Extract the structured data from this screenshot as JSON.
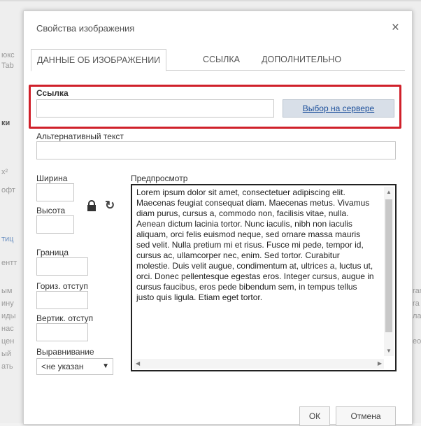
{
  "dialog": {
    "title": "Свойства изображения",
    "close_symbol": "×",
    "tabs": [
      {
        "label": "ДАННЫЕ ОБ ИЗОБРАЖЕНИИ",
        "active": true
      },
      {
        "label": "ССЫЛКА",
        "active": false
      },
      {
        "label": "ДОПОЛНИТЕЛЬНО",
        "active": false
      }
    ],
    "fields": {
      "link_label": "Ссылка",
      "link_value": "",
      "browse_server_label": "Выбор на сервере",
      "alt_label": "Альтернативный текст",
      "alt_value": "",
      "width_label": "Ширина",
      "height_label": "Высота",
      "border_label": "Граница",
      "hspace_label": "Гориз. отступ",
      "vspace_label": "Вертик. отступ",
      "align_label": "Выравнивание",
      "align_selected": "<не указан"
    },
    "preview": {
      "label": "Предпросмотр",
      "text": "Lorem ipsum dolor sit amet, consectetuer adipiscing elit. Maecenas feugiat consequat diam. Maecenas metus. Vivamus diam purus, cursus a, commodo non, facilisis vitae, nulla. Aenean dictum lacinia tortor. Nunc iaculis, nibh non iaculis aliquam, orci felis euismod neque, sed ornare massa mauris sed velit. Nulla pretium mi et risus. Fusce mi pede, tempor id, cursus ac, ullamcorper nec, enim. Sed tortor. Curabitur molestie. Duis velit augue, condimentum at, ultrices a, luctus ut, orci. Donec pellentesque egestas eros. Integer cursus, augue in cursus faucibus, eros pede bibendum sem, in tempus tellus justo quis ligula. Etiam eget tortor."
    },
    "buttons": {
      "ok": "ОК",
      "cancel": "Отмена"
    }
  },
  "background": {
    "fragments": [
      "юкс",
      "Tab",
      "ки",
      "x²",
      "офт",
      "тиц",
      "ентт",
      "ым",
      "ину",
      "иды",
      "нас",
      "цен",
      "ый",
      "ать",
      "ran",
      "ra",
      "лал",
      "ео"
    ]
  },
  "colors": {
    "highlight": "#d0202a",
    "link": "#1a4e9a"
  },
  "icons": [
    "lock-icon",
    "reset-size-icon",
    "close-icon"
  ]
}
